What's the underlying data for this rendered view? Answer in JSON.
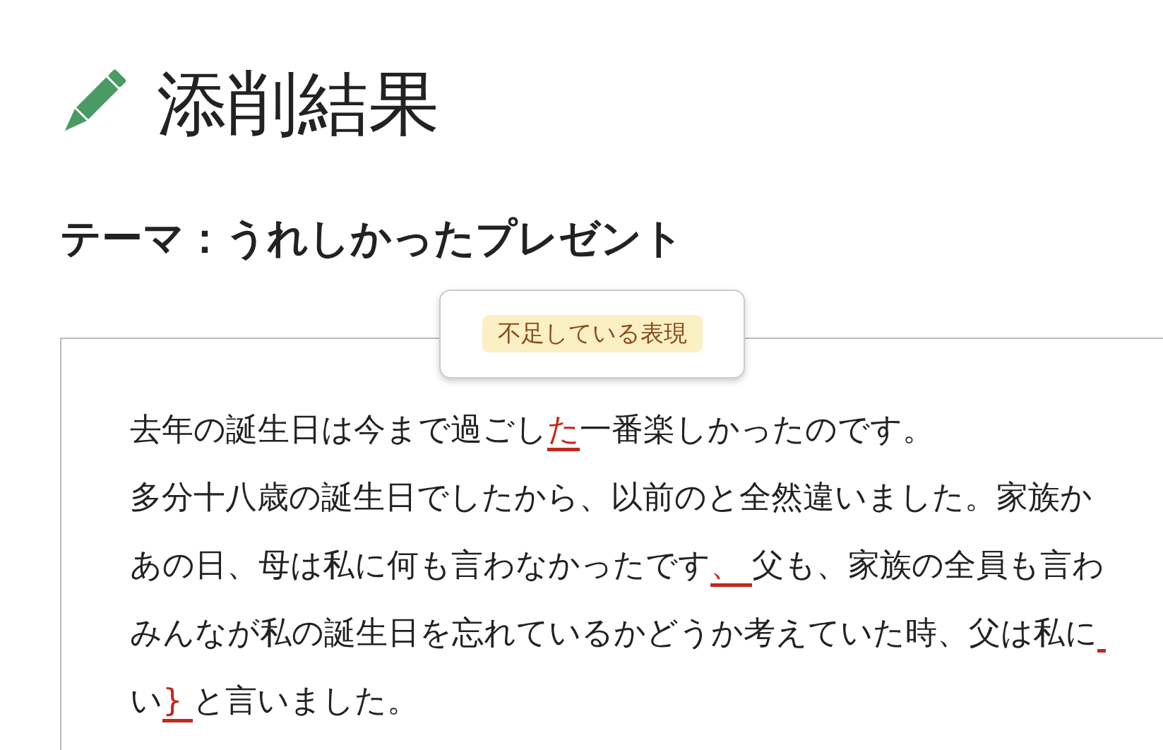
{
  "page_title": "添削結果",
  "theme": "テーマ：うれしかったプレゼント",
  "popup": {
    "tag": "不足している表現"
  },
  "essay_lines": [
    {
      "segments": [
        {
          "kind": "plain",
          "text": "去年の誕生日は今まで過ごし"
        },
        {
          "kind": "marked",
          "text": "た"
        },
        {
          "kind": "plain",
          "text": "一番楽しかったのです。"
        }
      ],
      "trailing_mark": false
    },
    {
      "segments": [
        {
          "kind": "plain",
          "text": "多分十八歳の誕生日でしたから、以前のと全然違いました。家族か"
        }
      ],
      "trailing_mark": false
    },
    {
      "segments": [
        {
          "kind": "plain",
          "text": "あの日、母は私に何も言わなかったです"
        },
        {
          "kind": "marked",
          "text": "、 "
        },
        {
          "kind": "plain",
          "text": "父も、家族の全員も言わ"
        }
      ],
      "trailing_mark": false
    },
    {
      "segments": [
        {
          "kind": "plain",
          "text": "みんなが私の誕生日を忘れているかどうか考えていた時、父は私に"
        }
      ],
      "trailing_mark": true
    },
    {
      "segments": [
        {
          "kind": "plain",
          "text": "い"
        },
        {
          "kind": "marked",
          "text": "} "
        },
        {
          "kind": "plain",
          "text": "と言いました。"
        }
      ],
      "trailing_mark": false
    }
  ]
}
